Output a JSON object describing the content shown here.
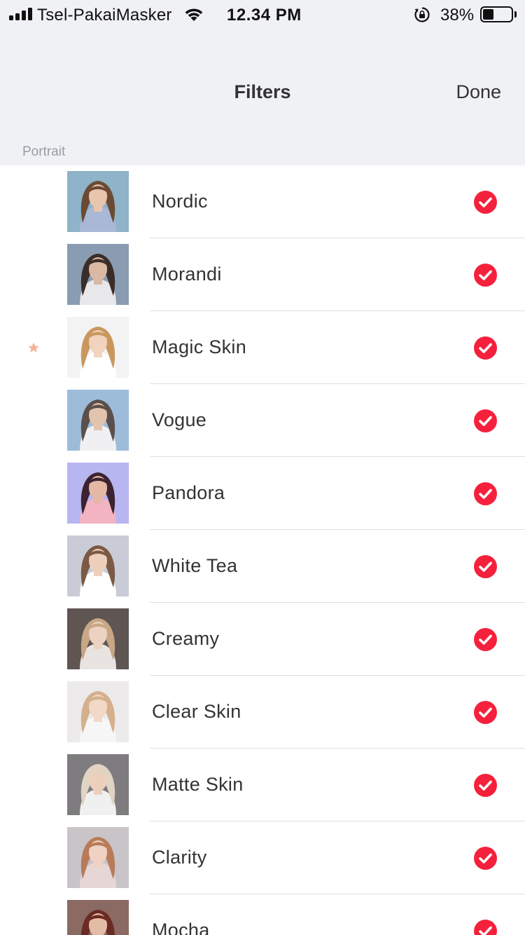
{
  "status_bar": {
    "carrier": "Tsel-PakaiMasker",
    "time": "12.34 PM",
    "battery_percent": "38%",
    "battery_level": 0.38,
    "signal_icon": "signal-bars-icon",
    "wifi_icon": "wifi-icon",
    "rotation_lock_icon": "rotation-lock-icon",
    "battery_icon": "battery-icon"
  },
  "nav": {
    "title": "Filters",
    "done_label": "Done"
  },
  "section": {
    "label": "Portrait"
  },
  "colors": {
    "accent": "#f5213c",
    "header_bg": "#f0f1f5",
    "star": "#f7b49a"
  },
  "filters": [
    {
      "name": "Nordic",
      "selected": true,
      "favorite": false,
      "thumb_bg": "#8fb3c8",
      "hair": "#6b4a34",
      "skin": "#e8c5ad",
      "cloth": "#a9b8d6"
    },
    {
      "name": "Morandi",
      "selected": true,
      "favorite": false,
      "thumb_bg": "#8a9cb1",
      "hair": "#3a2d28",
      "skin": "#d9b8a4",
      "cloth": "#e8e8ea"
    },
    {
      "name": "Magic Skin",
      "selected": true,
      "favorite": true,
      "thumb_bg": "#f3f3f3",
      "hair": "#c9975e",
      "skin": "#f1d3be",
      "cloth": "#ffffff"
    },
    {
      "name": "Vogue",
      "selected": true,
      "favorite": false,
      "thumb_bg": "#9cbcd9",
      "hair": "#5a4f4a",
      "skin": "#e2c3ae",
      "cloth": "#f0f0f2"
    },
    {
      "name": "Pandora",
      "selected": true,
      "favorite": false,
      "thumb_bg": "#b8b6f0",
      "hair": "#3b2330",
      "skin": "#e5b8a6",
      "cloth": "#f2b4c2"
    },
    {
      "name": "White Tea",
      "selected": true,
      "favorite": false,
      "thumb_bg": "#c9ccd6",
      "hair": "#7a5a42",
      "skin": "#edcfbb",
      "cloth": "#ffffff"
    },
    {
      "name": "Creamy",
      "selected": true,
      "favorite": false,
      "thumb_bg": "#5f5552",
      "hair": "#c8a786",
      "skin": "#ecd2c0",
      "cloth": "#e9e4e2"
    },
    {
      "name": "Clear Skin",
      "selected": true,
      "favorite": false,
      "thumb_bg": "#eceaea",
      "hair": "#d4b08c",
      "skin": "#f2d8c7",
      "cloth": "#f6f6f6"
    },
    {
      "name": "Matte Skin",
      "selected": true,
      "favorite": false,
      "thumb_bg": "#7f7c80",
      "hair": "#e0d4c2",
      "skin": "#ecd0bd",
      "cloth": "#f0f0f0"
    },
    {
      "name": "Clarity",
      "selected": true,
      "favorite": false,
      "thumb_bg": "#c9c4c8",
      "hair": "#b87b5a",
      "skin": "#efd2c2",
      "cloth": "#e6d6d6"
    },
    {
      "name": "Mocha",
      "selected": true,
      "favorite": false,
      "thumb_bg": "#8a6a62",
      "hair": "#6b2a22",
      "skin": "#e3bca8",
      "cloth": "#d9c2bb"
    }
  ]
}
